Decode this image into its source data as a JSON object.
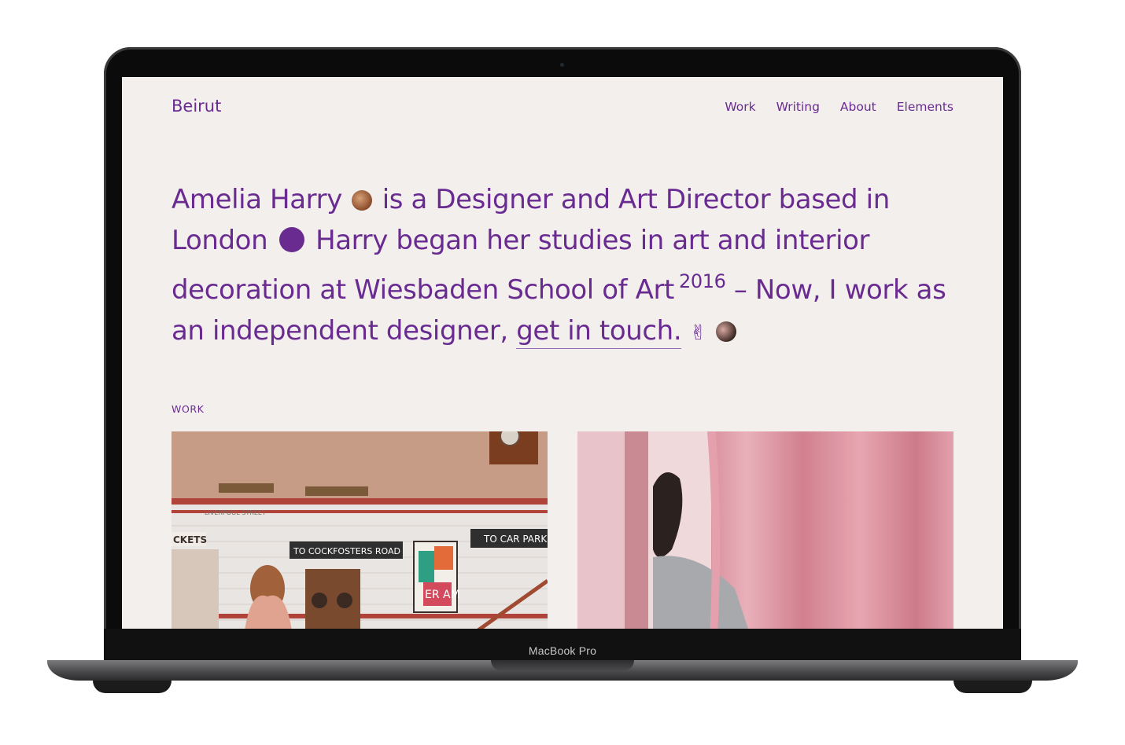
{
  "device": {
    "label": "MacBook Pro"
  },
  "site": {
    "brand": "Beirut",
    "nav": [
      "Work",
      "Writing",
      "About",
      "Elements"
    ]
  },
  "hero": {
    "part1": "Amelia Harry",
    "part2": "is a Designer and Art Director based in London",
    "part3": "Harry began her studies in art and interior decoration at Wiesbaden School of Art",
    "year": "2016",
    "part4": "– Now, I work as an independent designer,",
    "link": "get in touch.",
    "emoji": "✌"
  },
  "section": {
    "label": "WORK"
  },
  "cards": {
    "c1": {
      "sign_liverpool": "LIVERPOOL STREET",
      "sign_tickets": "CKETS",
      "sign_cockfosters": "TO COCKFOSTERS ROAD",
      "sign_carpark": "TO CAR PARK",
      "poster_text": "ER AM"
    }
  },
  "colors": {
    "accent": "#6a2b91",
    "background": "#f2efed"
  }
}
